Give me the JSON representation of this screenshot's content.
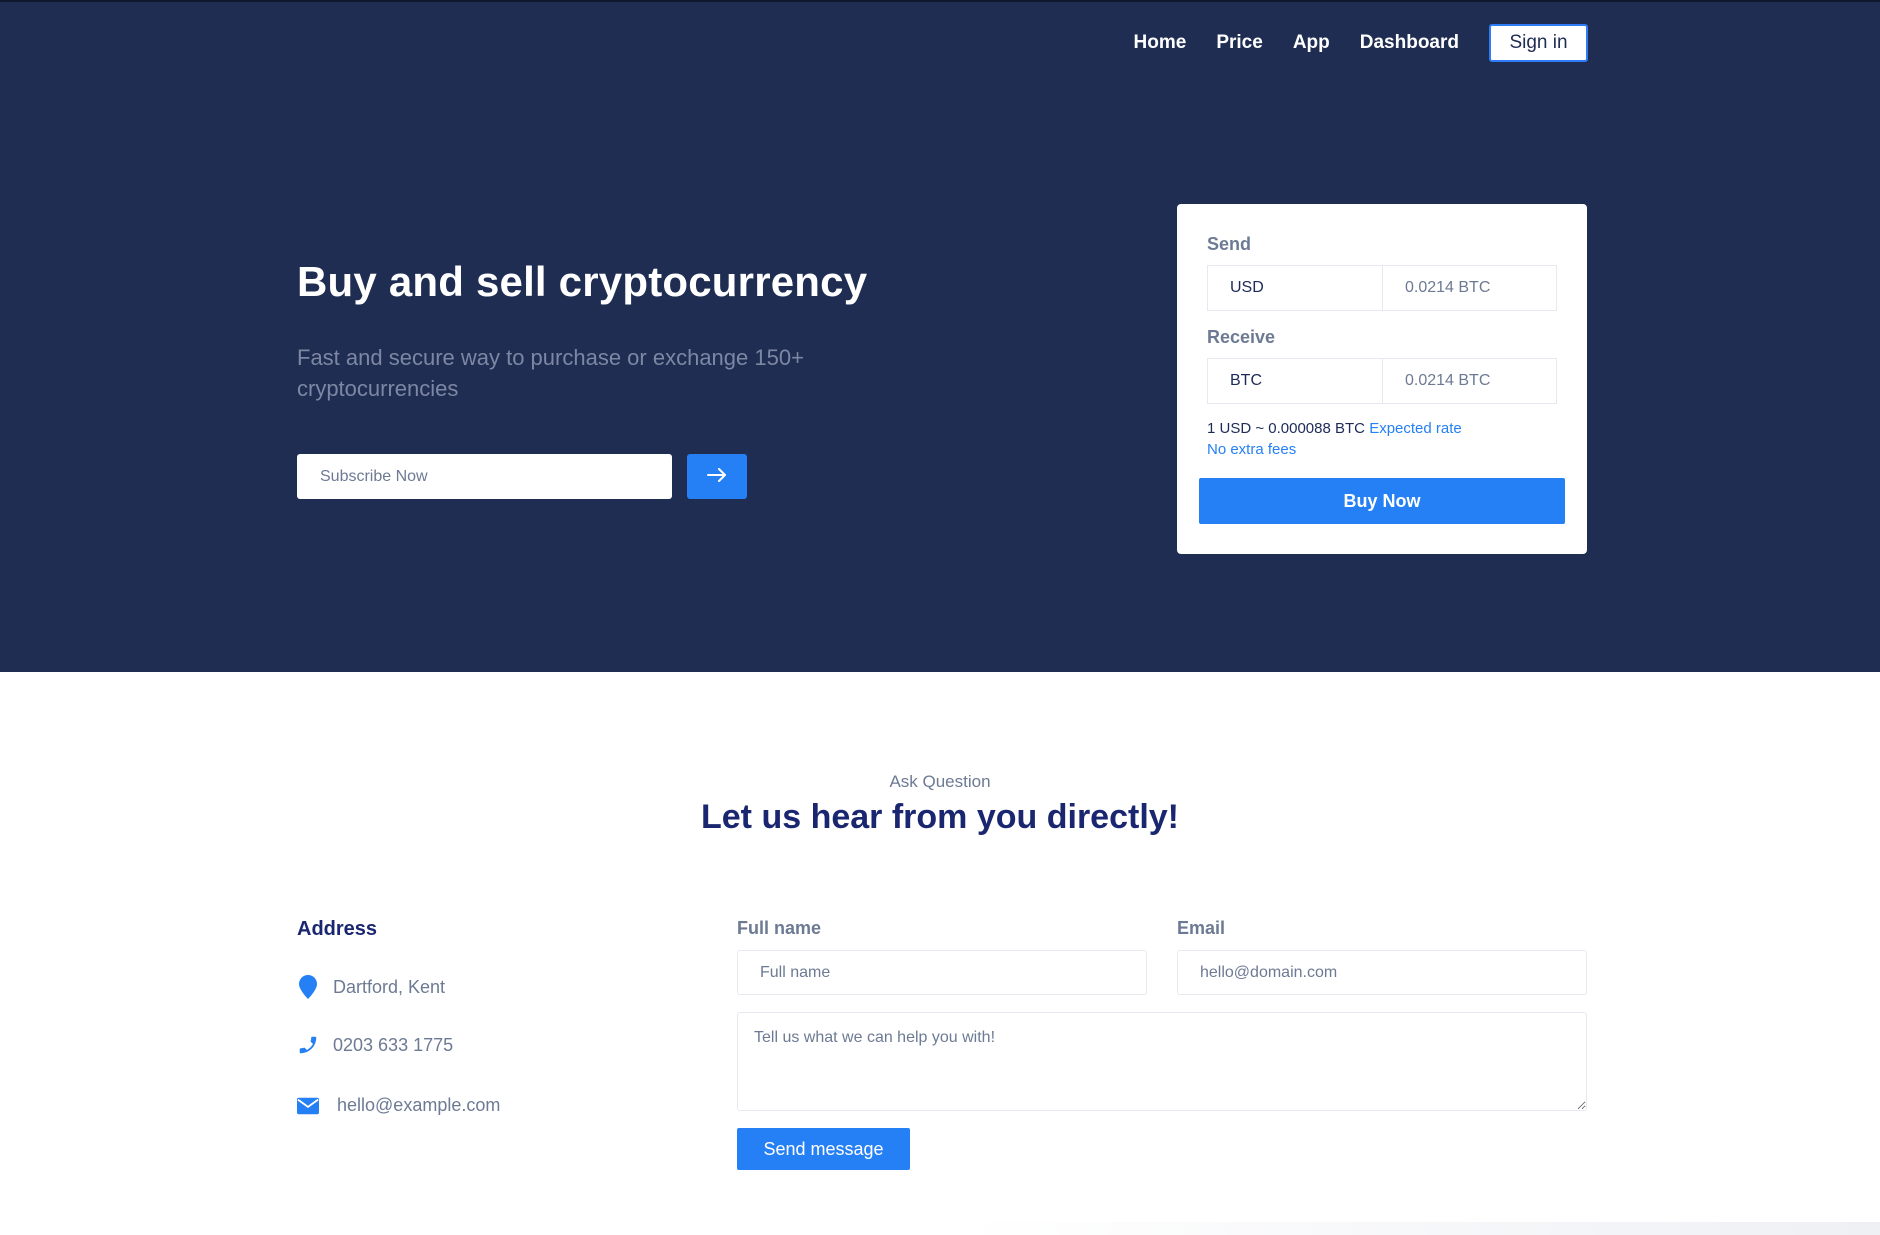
{
  "nav": {
    "items": [
      "Home",
      "Price",
      "App",
      "Dashboard"
    ],
    "signin": "Sign in"
  },
  "hero": {
    "title": "Buy and sell cryptocurrency",
    "subtitle": "Fast and secure way to purchase or exchange 150+ cryptocurrencies",
    "subscribe_placeholder": "Subscribe Now",
    "arrow_icon": "arrow-right-icon"
  },
  "exchange": {
    "send_label": "Send",
    "send_currency": "USD",
    "send_amount": "0.0214 BTC",
    "receive_label": "Receive",
    "receive_currency": "BTC",
    "receive_amount": "0.0214 BTC",
    "rate_text": "1 USD ~ 0.000088 BTC",
    "rate_note": "Expected rate",
    "fees_note": "No extra fees",
    "buy_label": "Buy Now"
  },
  "contact": {
    "eyebrow": "Ask Question",
    "title": "Let us hear from you directly!",
    "address_title": "Address",
    "location": "Dartford, Kent",
    "phone": "0203 633 1775",
    "email": "hello@example.com",
    "fullname_label": "Full name",
    "fullname_placeholder": "Full name",
    "email_label": "Email",
    "email_placeholder": "hello@domain.com",
    "message_placeholder": "Tell us what we can help you with!",
    "send_label": "Send message"
  },
  "colors": {
    "hero_bg": "#1f2d52",
    "accent": "#2580f5",
    "heading": "#1a2770",
    "muted": "#6d7a94"
  }
}
